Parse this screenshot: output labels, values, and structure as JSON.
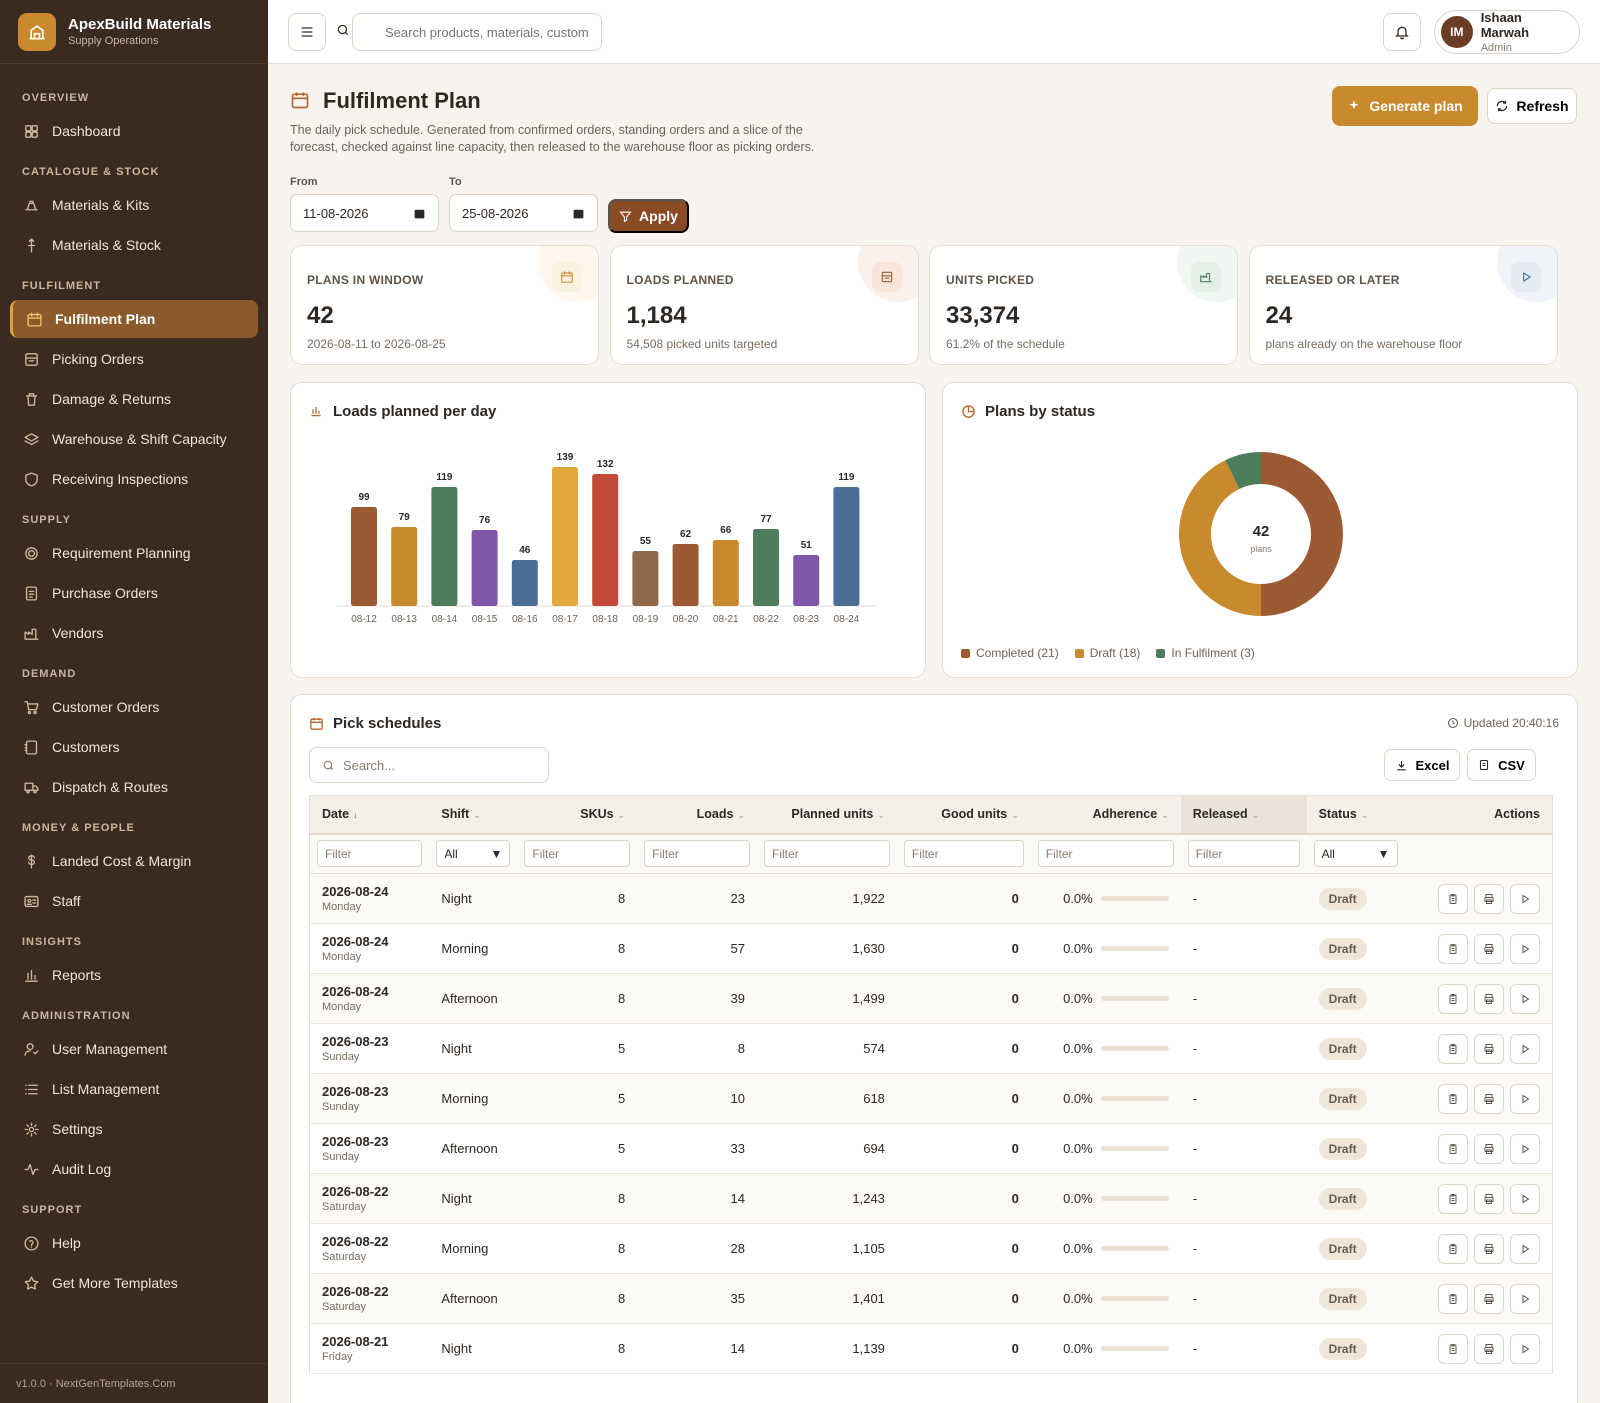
{
  "brand": {
    "name": "ApexBuild Materials",
    "subtitle": "Supply Operations"
  },
  "sidebar": {
    "sections": [
      {
        "label": "OVERVIEW",
        "items": [
          {
            "label": "Dashboard",
            "icon": "dashboard-icon"
          }
        ]
      },
      {
        "label": "CATALOGUE & STOCK",
        "items": [
          {
            "label": "Materials & Kits",
            "icon": "kit-icon"
          },
          {
            "label": "Materials & Stock",
            "icon": "stock-icon"
          }
        ]
      },
      {
        "label": "FULFILMENT",
        "items": [
          {
            "label": "Fulfilment Plan",
            "icon": "calendar-icon",
            "active": true
          },
          {
            "label": "Picking Orders",
            "icon": "box-icon"
          },
          {
            "label": "Damage & Returns",
            "icon": "trash-icon"
          },
          {
            "label": "Warehouse & Shift Capacity",
            "icon": "layers-icon"
          },
          {
            "label": "Receiving Inspections",
            "icon": "shield-icon"
          }
        ]
      },
      {
        "label": "SUPPLY",
        "items": [
          {
            "label": "Requirement Planning",
            "icon": "target-icon"
          },
          {
            "label": "Purchase Orders",
            "icon": "document-icon"
          },
          {
            "label": "Vendors",
            "icon": "factory-icon"
          }
        ]
      },
      {
        "label": "DEMAND",
        "items": [
          {
            "label": "Customer Orders",
            "icon": "cart-icon"
          },
          {
            "label": "Customers",
            "icon": "contacts-icon"
          },
          {
            "label": "Dispatch & Routes",
            "icon": "truck-icon"
          }
        ]
      },
      {
        "label": "MONEY & PEOPLE",
        "items": [
          {
            "label": "Landed Cost & Margin",
            "icon": "dollar-icon"
          },
          {
            "label": "Staff",
            "icon": "id-card-icon"
          }
        ]
      },
      {
        "label": "INSIGHTS",
        "items": [
          {
            "label": "Reports",
            "icon": "bar-chart-icon"
          }
        ]
      },
      {
        "label": "ADMINISTRATION",
        "items": [
          {
            "label": "User Management",
            "icon": "user-icon"
          },
          {
            "label": "List Management",
            "icon": "list-icon"
          },
          {
            "label": "Settings",
            "icon": "gear-icon"
          },
          {
            "label": "Audit Log",
            "icon": "activity-icon"
          }
        ]
      },
      {
        "label": "SUPPORT",
        "items": [
          {
            "label": "Help",
            "icon": "help-icon"
          },
          {
            "label": "Get More Templates",
            "icon": "star-icon"
          }
        ]
      }
    ],
    "footer": "v1.0.0 · NextGenTemplates.Com"
  },
  "topbar": {
    "search_placeholder": "Search products, materials, customers",
    "user": {
      "initials": "IM",
      "name": "Ishaan Marwah",
      "role": "Admin"
    }
  },
  "page": {
    "title": "Fulfilment Plan",
    "description": "The daily pick schedule. Generated from confirmed orders, standing orders and a slice of the forecast, checked against line capacity, then released to the warehouse floor as picking orders.",
    "generate_label": "Generate plan",
    "refresh_label": "Refresh"
  },
  "filters": {
    "from_label": "From",
    "from_value": "11-08-2026",
    "to_label": "To",
    "to_value": "25-08-2026",
    "apply_label": "Apply"
  },
  "kpis": [
    {
      "label": "PLANS IN WINDOW",
      "value": "42",
      "sub": "2026-08-11 to 2026-08-25",
      "icon": "calendar-icon",
      "color": "#c98a2e",
      "bg": "#fbf1e0"
    },
    {
      "label": "LOADS PLANNED",
      "value": "1,184",
      "sub": "54,508 picked units targeted",
      "icon": "box-icon",
      "color": "#9b5a33",
      "bg": "#f7e6da"
    },
    {
      "label": "UNITS PICKED",
      "value": "33,374",
      "sub": "61.2% of the schedule",
      "icon": "factory-icon",
      "color": "#4e7d5b",
      "bg": "#e4efe6"
    },
    {
      "label": "RELEASED OR LATER",
      "value": "24",
      "sub": "plans already on the warehouse floor",
      "icon": "play-icon",
      "color": "#4b6e97",
      "bg": "#e4ebf3"
    }
  ],
  "loads_chart": {
    "title": "Loads planned per day",
    "chart_data": {
      "type": "bar",
      "categories": [
        "08-12",
        "08-13",
        "08-14",
        "08-15",
        "08-16",
        "08-17",
        "08-18",
        "08-19",
        "08-20",
        "08-21",
        "08-22",
        "08-23",
        "08-24"
      ],
      "values": [
        99,
        79,
        119,
        76,
        46,
        139,
        132,
        55,
        62,
        66,
        77,
        51,
        119
      ],
      "colors": [
        "#9b5a33",
        "#c98a2e",
        "#4e7d5b",
        "#7e57a8",
        "#4b6e97",
        "#e3a83e",
        "#c24a3a",
        "#8e6a4b",
        "#9b5a33",
        "#c98a2e",
        "#4e7d5b",
        "#7e57a8",
        "#4b6e97"
      ],
      "ylim": [
        0,
        150
      ]
    }
  },
  "status_chart": {
    "title": "Plans by status",
    "center_value": "42",
    "center_label": "plans",
    "chart_data": {
      "type": "pie",
      "categories": [
        "Completed",
        "Draft",
        "In Fulfilment"
      ],
      "values": [
        21,
        18,
        3
      ],
      "colors": [
        "#9b5a33",
        "#c98a2e",
        "#4e7d5b"
      ]
    },
    "legend": [
      "Completed (21)",
      "Draft (18)",
      "In Fulfilment (3)"
    ]
  },
  "schedules": {
    "title": "Pick schedules",
    "updated": "Updated 20:40:16",
    "search_placeholder": "Search...",
    "excel_label": "Excel",
    "csv_label": "CSV",
    "columns": [
      "Date",
      "Shift",
      "SKUs",
      "Loads",
      "Planned units",
      "Good units",
      "Adherence",
      "Released",
      "Status",
      "Actions"
    ],
    "filter_placeholder": "Filter",
    "select_all": "All",
    "rows": [
      {
        "date": "2026-08-24",
        "day": "Monday",
        "shift": "Night",
        "skus": "8",
        "loads": "23",
        "planned": "1,922",
        "good": "0",
        "adherence": "0.0%",
        "adherence_pct": 0,
        "released": "-",
        "status": "Draft"
      },
      {
        "date": "2026-08-24",
        "day": "Monday",
        "shift": "Morning",
        "skus": "8",
        "loads": "57",
        "planned": "1,630",
        "good": "0",
        "adherence": "0.0%",
        "adherence_pct": 0,
        "released": "-",
        "status": "Draft"
      },
      {
        "date": "2026-08-24",
        "day": "Monday",
        "shift": "Afternoon",
        "skus": "8",
        "loads": "39",
        "planned": "1,499",
        "good": "0",
        "adherence": "0.0%",
        "adherence_pct": 0,
        "released": "-",
        "status": "Draft"
      },
      {
        "date": "2026-08-23",
        "day": "Sunday",
        "shift": "Night",
        "skus": "5",
        "loads": "8",
        "planned": "574",
        "good": "0",
        "adherence": "0.0%",
        "adherence_pct": 0,
        "released": "-",
        "status": "Draft"
      },
      {
        "date": "2026-08-23",
        "day": "Sunday",
        "shift": "Morning",
        "skus": "5",
        "loads": "10",
        "planned": "618",
        "good": "0",
        "adherence": "0.0%",
        "adherence_pct": 0,
        "released": "-",
        "status": "Draft"
      },
      {
        "date": "2026-08-23",
        "day": "Sunday",
        "shift": "Afternoon",
        "skus": "5",
        "loads": "33",
        "planned": "694",
        "good": "0",
        "adherence": "0.0%",
        "adherence_pct": 0,
        "released": "-",
        "status": "Draft"
      },
      {
        "date": "2026-08-22",
        "day": "Saturday",
        "shift": "Night",
        "skus": "8",
        "loads": "14",
        "planned": "1,243",
        "good": "0",
        "adherence": "0.0%",
        "adherence_pct": 0,
        "released": "-",
        "status": "Draft"
      },
      {
        "date": "2026-08-22",
        "day": "Saturday",
        "shift": "Morning",
        "skus": "8",
        "loads": "28",
        "planned": "1,105",
        "good": "0",
        "adherence": "0.0%",
        "adherence_pct": 0,
        "released": "-",
        "status": "Draft"
      },
      {
        "date": "2026-08-22",
        "day": "Saturday",
        "shift": "Afternoon",
        "skus": "8",
        "loads": "35",
        "planned": "1,401",
        "good": "0",
        "adherence": "0.0%",
        "adherence_pct": 0,
        "released": "-",
        "status": "Draft"
      },
      {
        "date": "2026-08-21",
        "day": "Friday",
        "shift": "Night",
        "skus": "8",
        "loads": "14",
        "planned": "1,139",
        "good": "0",
        "adherence": "0.0%",
        "adherence_pct": 0,
        "released": "-",
        "status": "Draft"
      }
    ]
  }
}
